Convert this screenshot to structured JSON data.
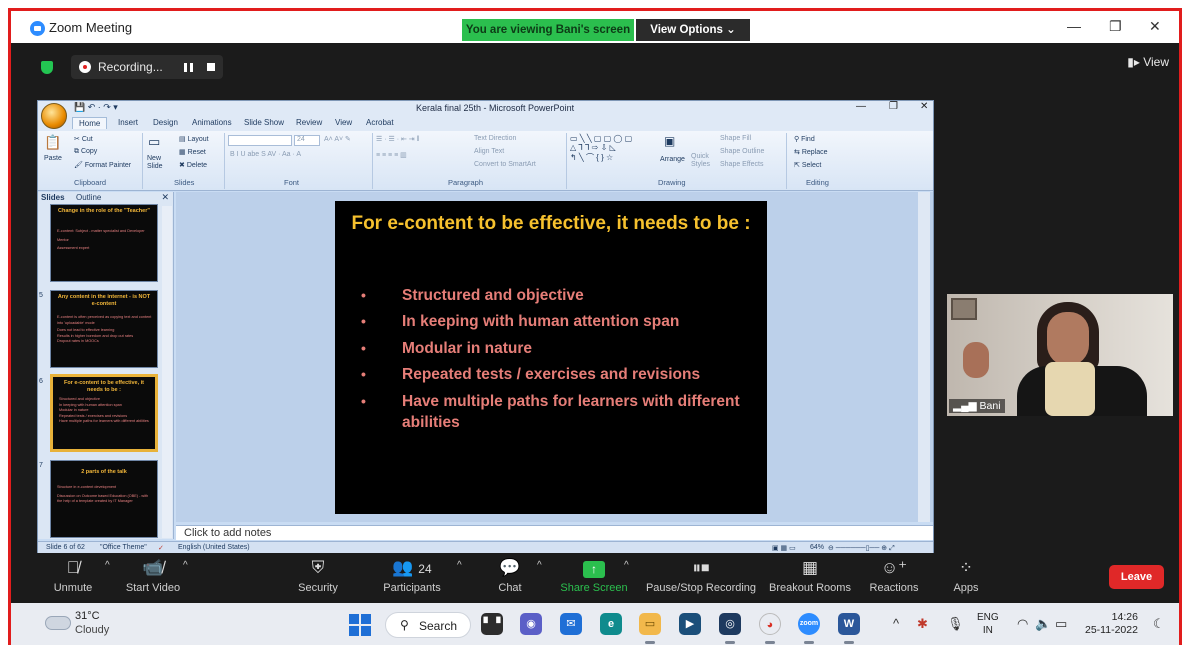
{
  "zoom": {
    "title": "Zoom Meeting",
    "banner": "You are viewing Bani's screen",
    "view_options": "View Options",
    "recording_label": "Recording...",
    "view_label": "View",
    "participant_name": "Bani",
    "participants_count": "24",
    "toolbar": {
      "unmute": "Unmute",
      "start_video": "Start Video",
      "security": "Security",
      "participants": "Participants",
      "chat": "Chat",
      "share_screen": "Share Screen",
      "pause_stop_recording": "Pause/Stop Recording",
      "breakout_rooms": "Breakout Rooms",
      "reactions": "Reactions",
      "apps": "Apps",
      "leave": "Leave"
    }
  },
  "ppt": {
    "window_title": "Kerala final 25th - Microsoft PowerPoint",
    "tabs": [
      "Home",
      "Insert",
      "Design",
      "Animations",
      "Slide Show",
      "Review",
      "View",
      "Acrobat"
    ],
    "ribbon": {
      "clipboard": {
        "label": "Clipboard",
        "paste": "Paste",
        "cut": "Cut",
        "copy": "Copy",
        "format_painter": "Format Painter"
      },
      "slides": {
        "label": "Slides",
        "new_slide": "New Slide",
        "layout": "Layout",
        "reset": "Reset",
        "delete": "Delete"
      },
      "font": {
        "label": "Font",
        "size": "24"
      },
      "paragraph": {
        "label": "Paragraph",
        "text_direction": "Text Direction",
        "align_text": "Align Text",
        "convert_smartart": "Convert to SmartArt"
      },
      "drawing": {
        "label": "Drawing",
        "arrange": "Arrange",
        "quick_styles": "Quick Styles",
        "shape_fill": "Shape Fill",
        "shape_outline": "Shape Outline",
        "shape_effects": "Shape Effects"
      },
      "editing": {
        "label": "Editing",
        "find": "Find",
        "replace": "Replace",
        "select": "Select"
      }
    },
    "pane_tabs": {
      "slides": "Slides",
      "outline": "Outline"
    },
    "thumbnails": [
      {
        "num": "",
        "title": "Change in the role of the \"Teacher\"",
        "lines": [
          "E-content: Subject - matter specialist and Developer",
          "Mentor",
          "Assessment expert"
        ],
        "selected": false
      },
      {
        "num": "5",
        "title": "Any content in the internet - is NOT e-content",
        "lines": [
          "E-content is often perceived as copying text and content into 'uploadable' mode",
          "Does not lead to effective learning",
          "Results in higher boredom and drop out rates",
          "Dropout rates in MOOCs"
        ],
        "selected": false
      },
      {
        "num": "6",
        "title": "For e-content to be effective, it needs to be :",
        "lines": [
          "Structured and objective",
          "In keeping with human attention span",
          "Modular in nature",
          "Repeated tests / exercises and revisions",
          "Have multiple paths for learners with different abilities"
        ],
        "selected": true
      },
      {
        "num": "7",
        "title": "2 parts of the talk",
        "lines": [
          "Structure in e-content development",
          "Discussion on Outcome based Education (OBE) - with the help of a template created by IT Manager"
        ],
        "selected": false
      }
    ],
    "slide": {
      "title": "For e-content to be effective, it needs to be :",
      "bullets": [
        "Structured and objective",
        "In keeping with human attention span",
        "Modular in nature",
        "Repeated tests / exercises and revisions",
        "Have multiple paths for learners with different abilities"
      ]
    },
    "notes_placeholder": "Click to add notes",
    "status": {
      "slide_of": "Slide 6 of 62",
      "theme": "\"Office Theme\"",
      "language": "English (United States)",
      "zoom": "64%"
    }
  },
  "taskbar": {
    "weather_temp": "31°C",
    "weather_cond": "Cloudy",
    "search": "Search",
    "lang_line1": "ENG",
    "lang_line2": "IN",
    "time": "14:26",
    "date": "25-11-2022"
  },
  "colors": {
    "zoom_banner": "#2bbf4e",
    "leave": "#e02828",
    "slide_title": "#f6c12e",
    "slide_bullet": "#e67e78",
    "frame_border": "#e11d1d"
  }
}
